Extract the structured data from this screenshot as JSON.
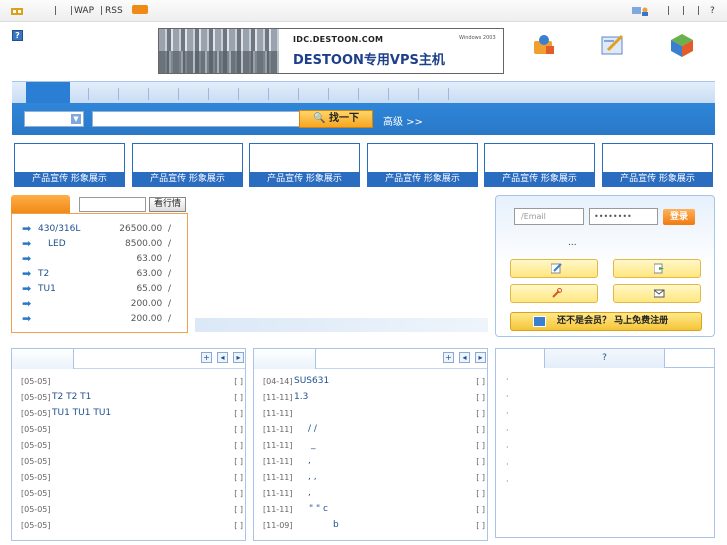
{
  "topbar": {
    "wap": "WAP",
    "rss": "RSS",
    "help": "?",
    "separators": [
      "|",
      "|",
      "|",
      "|",
      "|",
      "|",
      "|"
    ]
  },
  "header": {
    "logo_label": "?",
    "banner_domain": "IDC.DESTOON.COM",
    "banner_product": "DESTOON专用VPS主机",
    "banner_windows": "Windows 2003"
  },
  "search": {
    "button_label": "🔍 找一下",
    "advanced_label": "高级 >>"
  },
  "ads": {
    "caption": "产品宣传 形象展示"
  },
  "price": {
    "query_button": "看行情",
    "rows": [
      {
        "name": "430/316L",
        "price": "26500.00",
        "unit": "/"
      },
      {
        "name": "LED",
        "price": "8500.00",
        "unit": "/"
      },
      {
        "name": "",
        "price": "63.00",
        "unit": "/"
      },
      {
        "name": "T2",
        "price": "63.00",
        "unit": "/"
      },
      {
        "name": "TU1",
        "price": "65.00",
        "unit": "/"
      },
      {
        "name": "",
        "price": "200.00",
        "unit": "/"
      },
      {
        "name": "",
        "price": "200.00",
        "unit": "/"
      }
    ]
  },
  "login": {
    "email_placeholder": "/Email",
    "password_value": "••••••••",
    "login_button": "登录",
    "dots": "...",
    "register_label": "还不是会员？ 马上免费注册"
  },
  "left_list": {
    "controls": [
      "+",
      "◂",
      "▸"
    ],
    "rows": [
      {
        "date": "[05-05]",
        "text": "",
        "bracket": "[ ]"
      },
      {
        "date": "[05-05]",
        "text": "T2  T2  T1",
        "bracket": "[ ]"
      },
      {
        "date": "[05-05]",
        "text": "TU1  TU1  TU1",
        "bracket": "[ ]"
      },
      {
        "date": "[05-05]",
        "text": "",
        "bracket": "[ ]"
      },
      {
        "date": "[05-05]",
        "text": "",
        "bracket": "[ ]"
      },
      {
        "date": "[05-05]",
        "text": "",
        "bracket": "[ ]"
      },
      {
        "date": "[05-05]",
        "text": "",
        "bracket": "[ ]"
      },
      {
        "date": "[05-05]",
        "text": "",
        "bracket": "[ ]"
      },
      {
        "date": "[05-05]",
        "text": "",
        "bracket": "[ ]"
      },
      {
        "date": "[05-05]",
        "text": "",
        "bracket": "[ ]"
      }
    ]
  },
  "middle_list": {
    "controls": [
      "+",
      "◂",
      "▸"
    ],
    "rows": [
      {
        "date": "[04-14]",
        "text": "SUS631",
        "bracket": "[ ]"
      },
      {
        "date": "[11-11]",
        "text": "1.3",
        "bracket": "[ ]"
      },
      {
        "date": "[11-11]",
        "text": "",
        "bracket": "[ ]"
      },
      {
        "date": "[11-11]",
        "text": "/    /",
        "bracket": "[ ]"
      },
      {
        "date": "[11-11]",
        "text": "_",
        "bracket": "[ ]"
      },
      {
        "date": "[11-11]",
        "text": ",",
        "bracket": "[ ]"
      },
      {
        "date": "[11-11]",
        "text": ",       ,",
        "bracket": "[ ]"
      },
      {
        "date": "[11-11]",
        "text": ",",
        "bracket": "[ ]"
      },
      {
        "date": "[11-11]",
        "text": "\"       \"  c",
        "bracket": "[ ]"
      },
      {
        "date": "[11-09]",
        "text": "b",
        "bracket": "[ ]"
      }
    ]
  },
  "right_panel": {
    "tab2_label": "?",
    "bullets": [
      "·",
      "·",
      "·",
      "·",
      "·",
      "·",
      "·"
    ]
  }
}
